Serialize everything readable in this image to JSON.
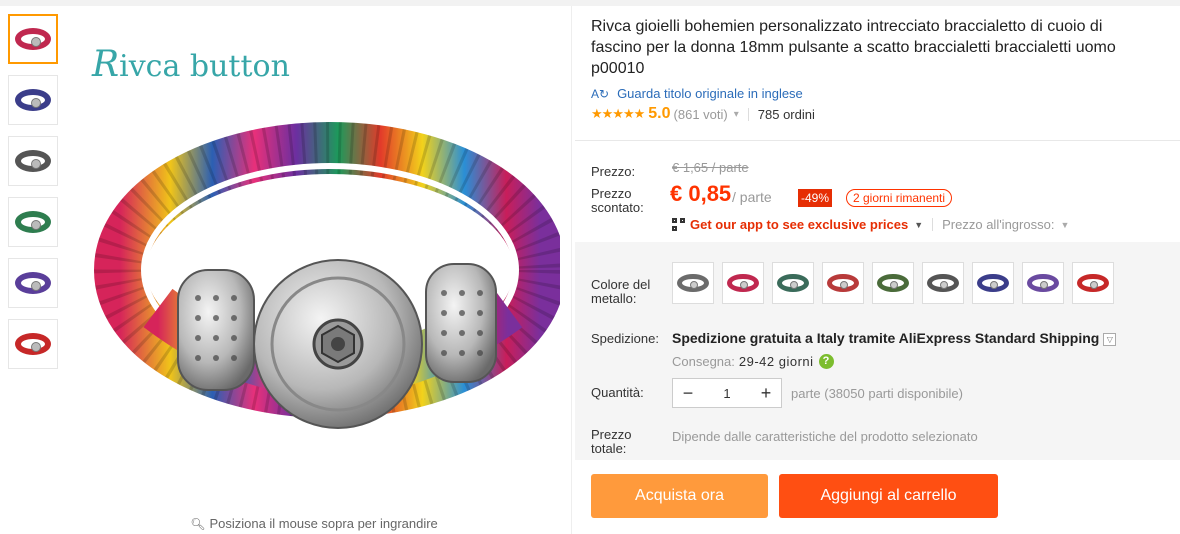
{
  "brand": {
    "text_cap": "R",
    "text_rest": "ivca button"
  },
  "gallery": {
    "thumbs": [
      {
        "color": "#c0284f",
        "active": true
      },
      {
        "color": "#3b3d8a",
        "active": false
      },
      {
        "color": "#555555",
        "active": false
      },
      {
        "color": "#2e7d4f",
        "active": false
      },
      {
        "color": "#5a3e9a",
        "active": false
      },
      {
        "color": "#c62828",
        "active": false
      }
    ],
    "zoom_hint": "Posiziona il mouse sopra per ingrandire"
  },
  "product": {
    "title": "Rivca gioielli bohemien personalizzato intrecciato braccialetto di cuoio di fascino per la donna 18mm pulsante a scatto braccialetti braccialetti uomo p00010",
    "original_title_link": "Guarda titolo originale in inglese",
    "stars": "★★★★★",
    "rating": "5.0",
    "votes": "(861 voti)",
    "orders": "785 ordini"
  },
  "price": {
    "price_label": "Prezzo:",
    "old_price": "€ 1,65 / parte",
    "discount_label_1": "Prezzo",
    "discount_label_2": "scontato:",
    "current_price": "€ 0,85",
    "unit": "/ parte",
    "discount": "-49%",
    "days_left": "2 giorni rimanenti",
    "app_link": "Get our app to see exclusive prices",
    "wholesale": "Prezzo all'ingrosso:"
  },
  "options": {
    "color_label_1": "Colore del",
    "color_label_2": "metallo:",
    "swatches": [
      "#6b6b6b",
      "#c0284f",
      "#3a6b5a",
      "#b83a3a",
      "#4a6b3a",
      "#555555",
      "#3b3d8a",
      "#6a4aa0",
      "#c62828"
    ],
    "shipping_label": "Spedizione:",
    "shipping_text": "Spedizione gratuita a Italy tramite AliExpress Standard Shipping",
    "delivery_label": "Consegna:",
    "delivery_days": "29-42 giorni",
    "quantity_label": "Quantità:",
    "quantity_minus": "−",
    "quantity_value": "1",
    "quantity_plus": "+",
    "quantity_available": "parte (38050 parti disponibile)",
    "total_label_1": "Prezzo",
    "total_label_2": "totale:",
    "total_note": "Dipende dalle caratteristiche del prodotto selezionato"
  },
  "actions": {
    "buy_now": "Acquista ora",
    "add_to_cart": "Aggiungi al carrello"
  }
}
